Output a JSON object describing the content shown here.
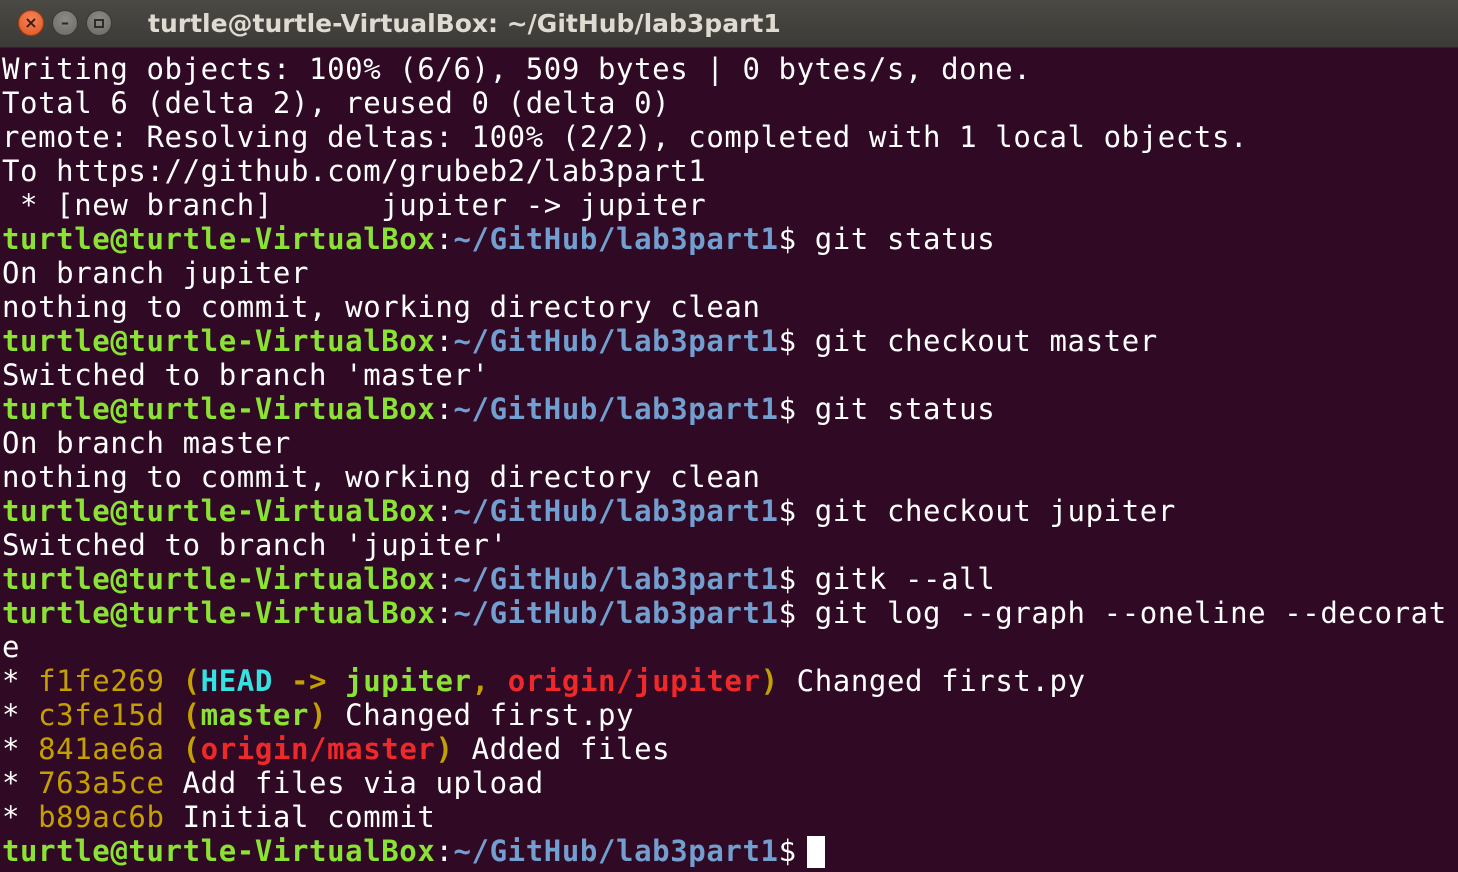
{
  "window": {
    "title": "turtle@turtle-VirtualBox: ~/GitHub/lab3part1",
    "close_label": "×",
    "minimize_label": "–"
  },
  "terminal": {
    "prompt_user": "turtle@turtle-VirtualBox",
    "prompt_sep": ":",
    "prompt_path": "~/GitHub/lab3part1",
    "prompt_dollar": "$",
    "output": {
      "l1": "Writing objects: 100% (6/6), 509 bytes | 0 bytes/s, done.",
      "l2": "Total 6 (delta 2), reused 0 (delta 0)",
      "l3": "remote: Resolving deltas: 100% (2/2), completed with 1 local objects.",
      "l4": "To https://github.com/grubeb2/lab3part1",
      "l5": " * [new branch]      jupiter -> jupiter",
      "l7": "On branch jupiter",
      "l8": "nothing to commit, working directory clean",
      "l10": "Switched to branch 'master'",
      "l12": "On branch master",
      "l13": "nothing to commit, working directory clean",
      "l15": "Switched to branch 'jupiter'",
      "l18": "e"
    },
    "commands": {
      "c1": " git status",
      "c2": " git checkout master",
      "c3": " git status",
      "c4": " git checkout jupiter",
      "c5": " gitk --all",
      "c6": " git log --graph --oneline --decorat"
    },
    "log": [
      {
        "star": "* ",
        "hash": "f1fe269",
        "open": " (",
        "head": "HEAD",
        "arrow": " -> ",
        "branch": "jupiter",
        "comma": ", ",
        "remote": "origin/jupiter",
        "close": ")",
        "msg": " Changed first.py"
      },
      {
        "star": "* ",
        "hash": "c3fe15d",
        "open": " (",
        "branch": "master",
        "close": ")",
        "msg": " Changed first.py"
      },
      {
        "star": "* ",
        "hash": "841ae6a",
        "open": " (",
        "remote": "origin/master",
        "close": ")",
        "msg": " Added files"
      },
      {
        "star": "* ",
        "hash": "763a5ce",
        "msg": " Add files via upload"
      },
      {
        "star": "* ",
        "hash": "b89ac6b",
        "msg": " Initial commit"
      }
    ],
    "final_command": ""
  },
  "colors": {
    "background": "#300a24",
    "prompt_user": "#8ae234",
    "prompt_path": "#729fcf",
    "hash": "#c4a000",
    "head": "#34e2e2",
    "remote": "#ef2929"
  }
}
